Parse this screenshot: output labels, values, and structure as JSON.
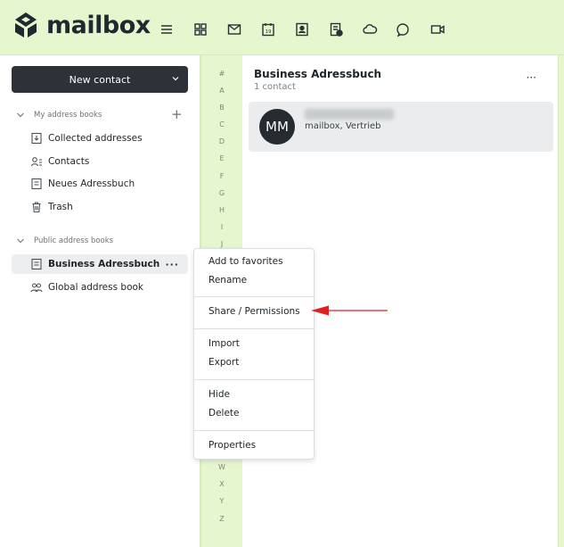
{
  "app": {
    "logo_text": "mailbox",
    "accent": "#e6f6cf",
    "brand_dark": "#1f2a30"
  },
  "nav": [
    {
      "name": "menu-icon"
    },
    {
      "name": "apps-icon"
    },
    {
      "name": "mail-icon"
    },
    {
      "name": "calendar-icon",
      "label": "19"
    },
    {
      "name": "contacts-icon"
    },
    {
      "name": "tasks-icon"
    },
    {
      "name": "cloud-icon"
    },
    {
      "name": "chat-icon"
    },
    {
      "name": "video-icon"
    }
  ],
  "sidebar": {
    "new_contact_label": "New contact",
    "my_books_label": "My address books",
    "public_books_label": "Public address books",
    "my_books": [
      "Collected addresses",
      "Contacts",
      "Neues Adressbuch",
      "Trash"
    ],
    "public_books": [
      "Business Adressbuch",
      "Global address book"
    ],
    "more_label": "···"
  },
  "alphabet": [
    "#",
    "A",
    "B",
    "C",
    "D",
    "E",
    "F",
    "G",
    "H",
    "I",
    "J",
    "W",
    "X",
    "Y",
    "Z"
  ],
  "list": {
    "title": "Business Adressbuch",
    "count": "1 contact",
    "more_label": "···",
    "contact": {
      "initials": "MM",
      "subtitle": "mailbox, Vertrieb"
    }
  },
  "context_menu": {
    "add_favorites": "Add to favorites",
    "rename": "Rename",
    "share": "Share / Permissions",
    "import": "Import",
    "export": "Export",
    "hide": "Hide",
    "delete": "Delete",
    "properties": "Properties"
  },
  "annotation_color": "#e02020"
}
